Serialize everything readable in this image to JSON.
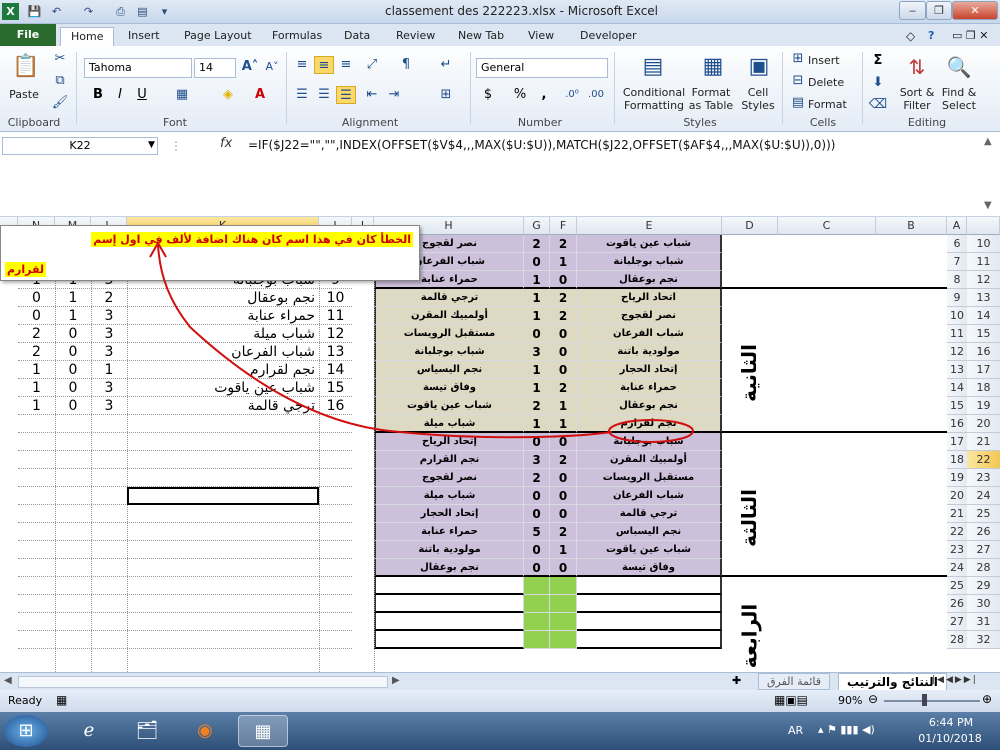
{
  "window": {
    "title": "classement des 222223.xlsx  -  Microsoft Excel",
    "min": "‒",
    "max": "❐",
    "close": "✕"
  },
  "tabs": [
    "File",
    "Home",
    "Insert",
    "Page Layout",
    "Formulas",
    "Data",
    "Review",
    "New Tab",
    "View",
    "Developer"
  ],
  "ribbon": {
    "clipboard": {
      "paste": "Paste",
      "label": "Clipboard"
    },
    "font": {
      "name": "Tahoma",
      "size": "14",
      "label": "Font",
      "bold": "B",
      "italic": "I",
      "underline": "U"
    },
    "alignment": {
      "label": "Alignment"
    },
    "number": {
      "format": "General",
      "label": "Number",
      "currency": "$",
      "percent": "%",
      "comma": ","
    },
    "styles": {
      "conditional": "Conditional Formatting",
      "table": "Format as Table",
      "cell": "Cell Styles",
      "label": "Styles"
    },
    "cells": {
      "insert": "Insert",
      "delete": "Delete",
      "format": "Format",
      "label": "Cells"
    },
    "editing": {
      "sum": "Σ",
      "sort": "Sort & Filter",
      "find": "Find & Select",
      "label": "Editing"
    }
  },
  "formula_bar": {
    "name_box": "K22",
    "fx": "fx",
    "formula": "=IF($J22=\"\",\"\",INDEX(OFFSET($V$4,,,MAX($U:$U)),MATCH($J22,OFFSET($AF$4,,,MAX($U:$U)),0)))"
  },
  "columns": [
    "N",
    "M",
    "L",
    "K",
    "J",
    "I",
    "H",
    "G",
    "F",
    "E",
    "D",
    "C",
    "B",
    "A"
  ],
  "row_numbers": [
    6,
    7,
    8,
    9,
    10,
    11,
    12,
    13,
    14,
    15,
    16,
    17,
    18,
    19,
    20,
    21,
    22,
    23,
    24,
    25,
    26,
    27,
    28
  ],
  "row_numbers_right": [
    10,
    11,
    12,
    13,
    14,
    15,
    16,
    17,
    18,
    19,
    20,
    21,
    22,
    23,
    24,
    25,
    26,
    27,
    28,
    29,
    30,
    31,
    32
  ],
  "comment": {
    "line1": "الخطأ كان في هذا اسم كان هناك اضافة لألف في اول إسم",
    "line2": "لقرارم"
  },
  "left_table": [
    {
      "n": "1",
      "m": "1",
      "l": "3",
      "k": "شباب بوجلبانة",
      "j": "9"
    },
    {
      "n": "0",
      "m": "1",
      "l": "2",
      "k": "نجم بوعقال",
      "j": "10"
    },
    {
      "n": "0",
      "m": "1",
      "l": "3",
      "k": "حمراء عنابة",
      "j": "11"
    },
    {
      "n": "2",
      "m": "0",
      "l": "3",
      "k": "شباب ميلة",
      "j": "12"
    },
    {
      "n": "2",
      "m": "0",
      "l": "3",
      "k": "شباب الفرعان",
      "j": "13"
    },
    {
      "n": "1",
      "m": "0",
      "l": "1",
      "k": "نجم لقرارم",
      "j": "14"
    },
    {
      "n": "1",
      "m": "0",
      "l": "3",
      "k": "شباب عين ياقوت",
      "j": "15"
    },
    {
      "n": "1",
      "m": "0",
      "l": "3",
      "k": "ترجي قالمة",
      "j": "16"
    }
  ],
  "matches": [
    {
      "h": "نصر لقجوج",
      "g": "2",
      "f": "2",
      "e": "شباب عين ياقوت",
      "c": "purple"
    },
    {
      "h": "شباب الفرعان",
      "g": "0",
      "f": "1",
      "e": "شباب بوجلبانة",
      "c": "purple"
    },
    {
      "h": "حمراء عنابة",
      "g": "1",
      "f": "0",
      "e": "نجم بوعقال",
      "c": "purple"
    },
    {
      "h": "ترجي قالمة",
      "g": "1",
      "f": "2",
      "e": "اتحاد الرياح",
      "c": "tan"
    },
    {
      "h": "أولمبيك المقرن",
      "g": "1",
      "f": "2",
      "e": "نصر لقجوج",
      "c": "tan"
    },
    {
      "h": "مستقبل الرويسات",
      "g": "0",
      "f": "0",
      "e": "شباب الفرعان",
      "c": "tan"
    },
    {
      "h": "شباب بوجلبانة",
      "g": "3",
      "f": "0",
      "e": "مولودية باتنة",
      "c": "tan"
    },
    {
      "h": "نجم اليسياس",
      "g": "1",
      "f": "0",
      "e": "إتحاد الحجار",
      "c": "tan"
    },
    {
      "h": "وفاق تيسة",
      "g": "1",
      "f": "2",
      "e": "حمراء عنابة",
      "c": "tan"
    },
    {
      "h": "شباب عين ياقوت",
      "g": "2",
      "f": "1",
      "e": "نجم بوعقال",
      "c": "tan"
    },
    {
      "h": "شباب ميلة",
      "g": "1",
      "f": "1",
      "e": "نجم لقرارم",
      "c": "tan"
    },
    {
      "h": "إتحاد الرياح",
      "g": "0",
      "f": "0",
      "e": "شباب بوجلبانة",
      "c": "purple"
    },
    {
      "h": "نجم القرارم",
      "g": "3",
      "f": "2",
      "e": "أولمبيك المقرن",
      "c": "purple"
    },
    {
      "h": "نصر لقجوج",
      "g": "2",
      "f": "0",
      "e": "مستقبل الرويسات",
      "c": "purple"
    },
    {
      "h": "شباب ميلة",
      "g": "0",
      "f": "0",
      "e": "شباب الفرعان",
      "c": "purple"
    },
    {
      "h": "إتحاد الحجار",
      "g": "0",
      "f": "0",
      "e": "ترجي قالمة",
      "c": "purple"
    },
    {
      "h": "حمراء عنابة",
      "g": "5",
      "f": "2",
      "e": "نجم اليسباس",
      "c": "purple"
    },
    {
      "h": "مولودية باتنة",
      "g": "0",
      "f": "1",
      "e": "شباب عين ياقوت",
      "c": "purple"
    },
    {
      "h": "نجم بوعقال",
      "g": "0",
      "f": "0",
      "e": "وفاق تيسة",
      "c": "purple"
    }
  ],
  "round_labels": {
    "second": "الثانية",
    "third": "الثالثة",
    "fourth": "الرابعة"
  },
  "sheet_tabs": [
    "النتائج والترتيب",
    "قائمة الفرق"
  ],
  "status": {
    "ready": "Ready",
    "zoom": "90%"
  },
  "taskbar": {
    "lang": "AR",
    "time": "6:44 PM",
    "date": "01/10/2018"
  }
}
